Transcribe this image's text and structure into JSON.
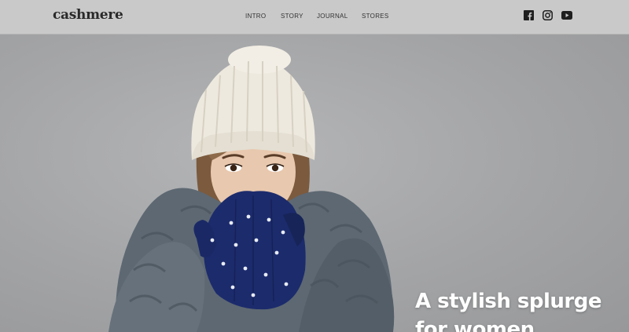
{
  "brand": {
    "logo_text": "cashmere"
  },
  "nav": {
    "items": [
      "INTRO",
      "STORY",
      "JOURNAL",
      "STORES"
    ]
  },
  "social": {
    "icons": [
      "facebook-icon",
      "instagram-icon",
      "youtube-icon"
    ]
  },
  "hero": {
    "headline_line1": "A stylish splurge",
    "headline_line2": "for women"
  },
  "colors": {
    "header_bg": "#c9c9c9",
    "hero_bg": "#a5a6a8",
    "headline": "#ffffff",
    "hat": "#efeae0",
    "scarf": "#5b6670",
    "mittens": "#1a2a6a"
  }
}
